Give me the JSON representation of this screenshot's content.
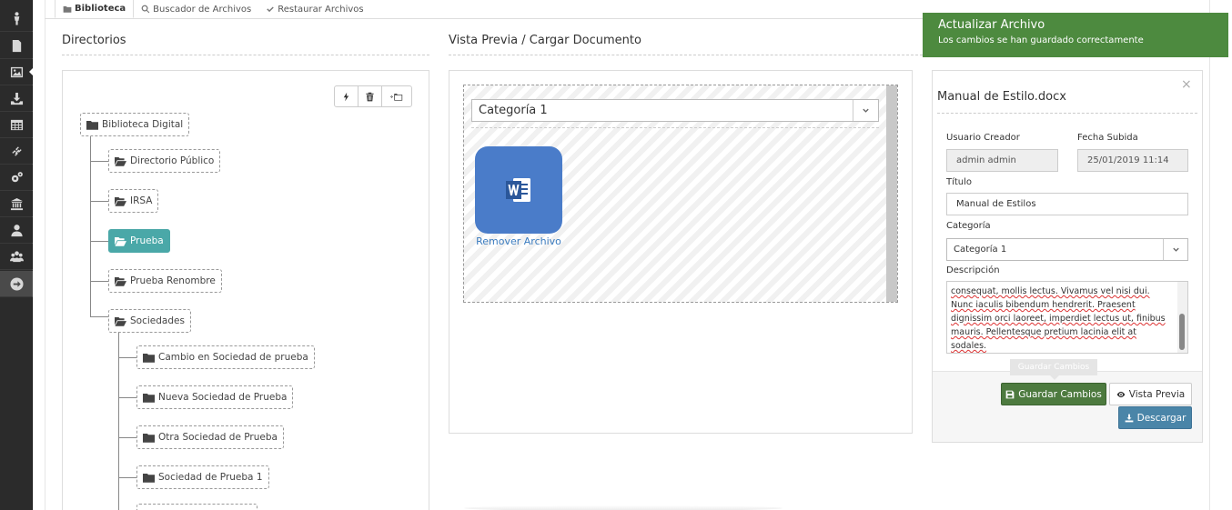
{
  "sidebar": {
    "items": [
      {
        "icon": "user-standing-icon"
      },
      {
        "icon": "document-icon"
      },
      {
        "icon": "image-icon",
        "active": true
      },
      {
        "icon": "download-tray-icon"
      },
      {
        "icon": "table-icon"
      },
      {
        "icon": "link-icon"
      },
      {
        "icon": "gears-icon"
      },
      {
        "icon": "bank-icon"
      },
      {
        "icon": "user-icon"
      },
      {
        "icon": "users-icon"
      },
      {
        "icon": "exit-arrow-icon"
      }
    ]
  },
  "tabs": [
    {
      "label": "Biblioteca",
      "icon": "folder-icon",
      "active": true
    },
    {
      "label": "Buscador de Archivos",
      "icon": "search-icon"
    },
    {
      "label": "Restaurar Archivos",
      "icon": "check-icon"
    }
  ],
  "directories": {
    "title": "Directorios",
    "toolbar": {
      "flash": "flash-icon",
      "delete": "trash-icon",
      "new_folder": "add-folder-icon"
    },
    "tree": {
      "root": "Biblioteca Digital",
      "level1": [
        "Directorio Público",
        "IRSA",
        "Prueba",
        "Prueba Renombre",
        "Sociedades"
      ],
      "selected": "Prueba",
      "sociedades_children": [
        "Cambio en Sociedad de prueba",
        "Nueva Sociedad de Prueba",
        "Otra Sociedad de Prueba",
        "Sociedad de Prueba 1"
      ]
    }
  },
  "preview": {
    "title": "Vista Previa / Cargar Documento",
    "category": "Categoría 1",
    "file_icon": "word-document-icon",
    "remove_label": "Remover Archivo"
  },
  "edit": {
    "file_name": "Manual de Estilo.docx",
    "close": "×",
    "creator_label": "Usuario Creador",
    "creator_value": "admin admin",
    "date_label": "Fecha Subida",
    "date_value": "25/01/2019 11:14",
    "title_label": "Título",
    "title_value": "Manual de Estilos",
    "category_label": "Categoría",
    "category_value": "Categoría 1",
    "description_label": "Descripción",
    "description_lines": [
      "consequat, mollis lectus. Vivamus vel nisi dui.",
      "Nunc iaculis bibendum hendrerit. Praesent",
      "dignissim orci laoreet, imperdiet lectus ut, finibus",
      "mauris. Pellentesque pretium lacinia elit at",
      "sodales."
    ],
    "tooltip": "Guardar Cambios",
    "save_label": "Guardar Cambios",
    "preview_label": "Vista Previa",
    "download_label": "Descargar"
  },
  "toast": {
    "title": "Actualizar Archivo",
    "message": "Los cambios se han guardado correctamente"
  },
  "colors": {
    "selected_node": "#4aa8a8",
    "save_button": "#4d7a3f",
    "download_button": "#4a85a8",
    "toast": "#4d8a3f",
    "word_icon": "#4a7cc9"
  }
}
